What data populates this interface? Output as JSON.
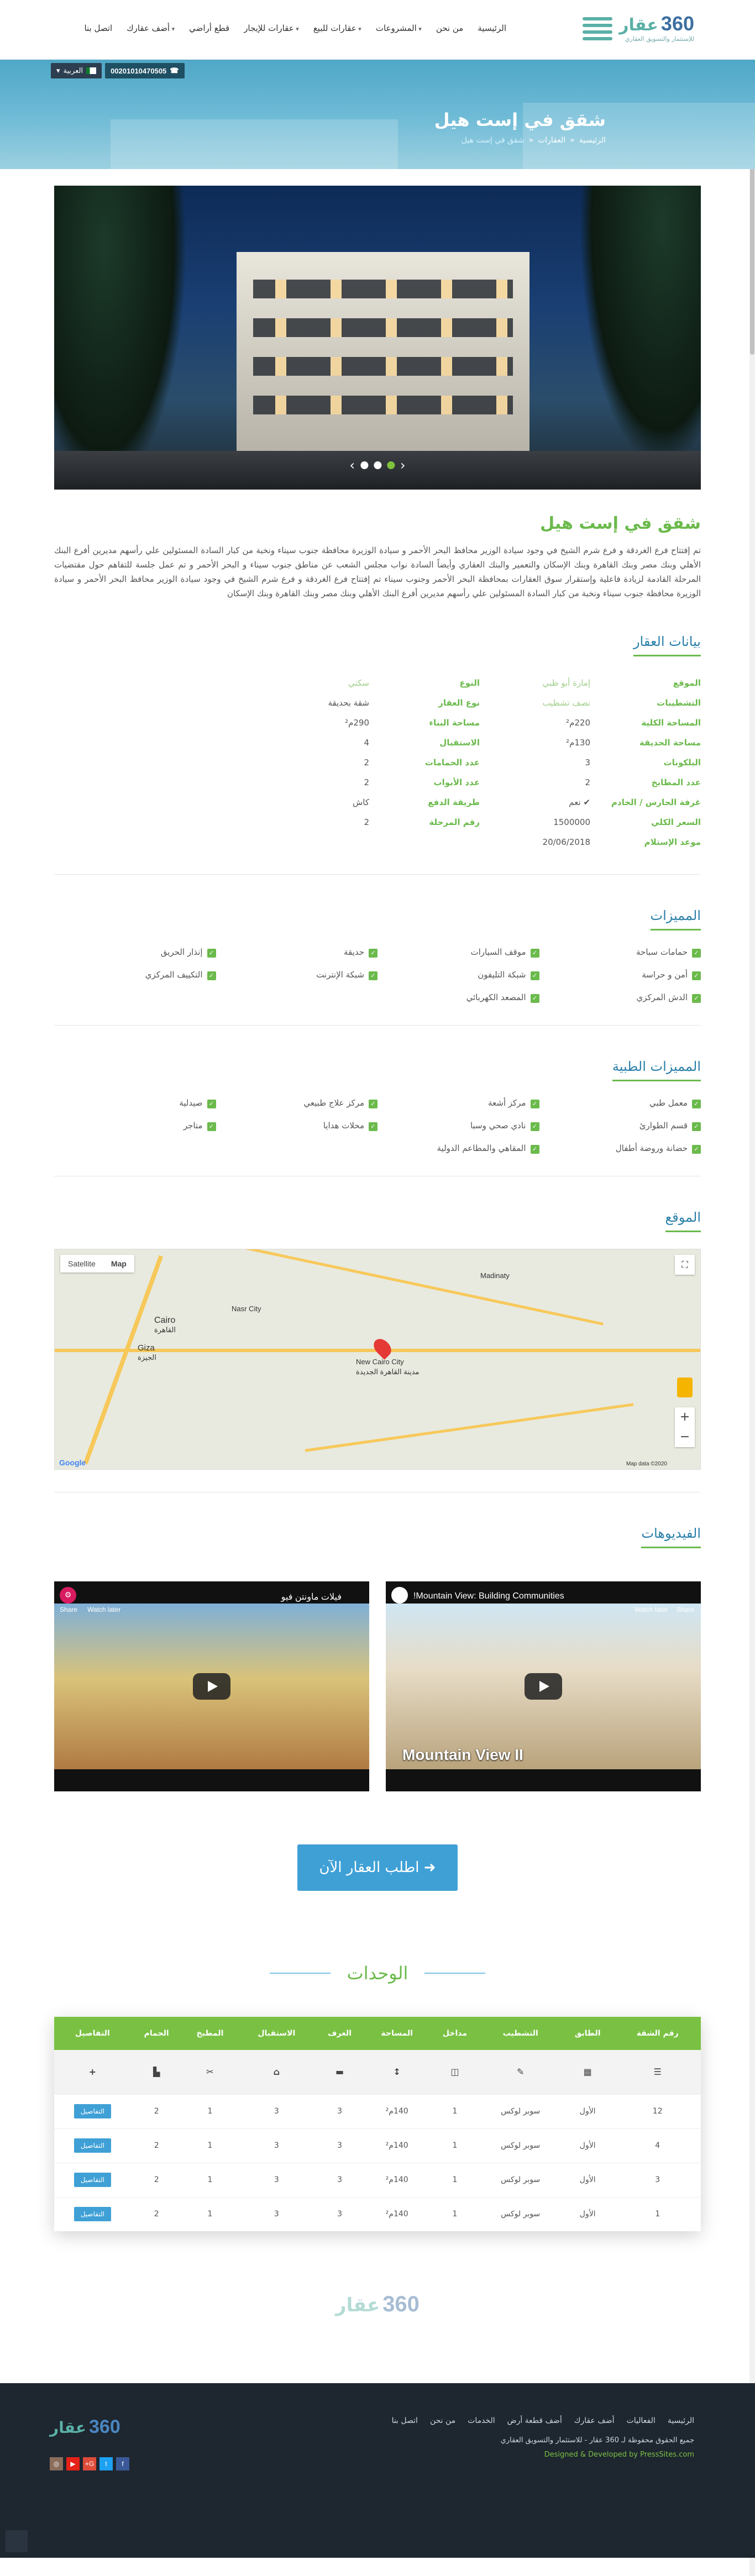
{
  "nav": {
    "logo_num": "360",
    "logo_word": "عقار",
    "logo_slogan": "للإستثمار والتسويق العقاري",
    "items": [
      "الرئيسية",
      "من نحن",
      "المشروعات",
      "عقارات للبيع",
      "عقارات للإيجار",
      "قطع أراضي",
      "أضف عقارك",
      "اتصل بنا"
    ]
  },
  "hero": {
    "title": "شقق في إست هيل",
    "crumbs": [
      "الرئيسية",
      "العقارات",
      "شقق في إست هيل"
    ],
    "phone": "00201010470505",
    "lang": "العربية"
  },
  "property": {
    "heading": "شقق في إست هيل",
    "description": "تم إفتتاح فرع الغردقة و فرع شرم الشيخ في وجود سيادة الوزير محافظ البحر الأحمر و سيادة الوزيرة محافظة جنوب سيناء ونخبة من كبار السادة المسئولين علي رأسهم مديرين أفرع البنك الأهلي وبنك مصر وبنك القاهرة وبنك الإسكان والتعمير والبنك العقاري وأيضاً السادة نواب مجلس الشعب عن مناطق جنوب سيناء و البحر الأحمر و تم عمل جلسة للتفاهم حول مقتضيات المرحلة القادمة لزيادة فاعلية وإستقرار سوق العقارات بمحافظة البحر الأحمر وجنوب سيناء تم إفتتاح فرع الغردقة و فرع شرم الشيخ في وجود سيادة الوزير محافظ البحر الأحمر و سيادة الوزيرة محافظة جنوب سيناء ونخبة من كبار السادة المسئولين علي رأسهم مديرين أفرع البنك الأهلي وبنك مصر وبنك القاهرة وبنك الإسكان"
  },
  "details": {
    "title": "بيانات العقار",
    "rows": [
      {
        "k1": "الموقع",
        "v1": "إمارة أبو ظبي",
        "k2": "النوع",
        "v2": "سكني",
        "green": true
      },
      {
        "k1": "التشطيبات",
        "v1": "نصف تشطيب",
        "k2": "نوع العقار",
        "v2": "شقة بحديقة",
        "green1": true
      },
      {
        "k1": "المساحة الكلية",
        "v1": "220م²",
        "k2": "مساحة البناء",
        "v2": "290م²"
      },
      {
        "k1": "مساحة الحديقة",
        "v1": "130م²",
        "k2": "الاستقبال",
        "v2": "4"
      },
      {
        "k1": "البلكونات",
        "v1": "3",
        "k2": "عدد الحمامات",
        "v2": "2"
      },
      {
        "k1": "عدد المطابخ",
        "v1": "2",
        "k2": "عدد الأبواب",
        "v2": "2"
      },
      {
        "k1": "غرفة الحارس / الخادم",
        "v1": "✔ نعم",
        "k2": "طريقة الدفع",
        "v2": "كاش"
      },
      {
        "k1": "السعر الكلي",
        "v1": "1500000",
        "k2": "رقم المرحلة",
        "v2": "2"
      },
      {
        "k1": "موعد الإستلام",
        "v1": "20/06/2018",
        "k2": "",
        "v2": ""
      }
    ]
  },
  "features": {
    "title": "المميزات",
    "items": [
      "حمامات سباحة",
      "موقف السيارات",
      "حديقة",
      "إنذار الحريق",
      "أمن و حراسة",
      "شبكة التليفون",
      "شبكة الإنترنت",
      "التكييف المركزي",
      "الدش المركزي",
      "المصعد الكهربائي"
    ]
  },
  "amenities": {
    "title": "المميزات الطبية",
    "items": [
      "معمل طبي",
      "مركز أشعة",
      "مركز علاج طبيعي",
      "صيدلية",
      "قسم الطوارئ",
      "نادي صحي وسبا",
      "محلات هدايا",
      "متاجر",
      "حضانة وروضة أطفال",
      "المقاهي والمطاعم الدولية"
    ]
  },
  "location": {
    "title": "الموقع",
    "map_tab": "Map",
    "sat_tab": "Satellite",
    "city": "Cairo",
    "city_ar": "القاهرة",
    "giza": "Giza",
    "giza_ar": "الجيزة",
    "new_cairo": "New Cairo City",
    "new_cairo_ar": "مدينة القاهرة الجديدة",
    "madinaty": "Madinaty",
    "nasr": "Nasr City",
    "google": "Google",
    "map_data": "Map data ©2020"
  },
  "videos": {
    "title": "الفيديوهات",
    "v1_title": "Mountain View: Building Communities!",
    "v1_caption": "Mountain View II",
    "v2_title": "فيلات ماونتن فيو",
    "watch_later": "Watch later",
    "share": "Share"
  },
  "cta": {
    "label": "اطلب العقار الآن"
  },
  "units": {
    "title": "الوحدات",
    "headers": [
      "رقم الشقة",
      "الطابق",
      "التشطيب",
      "مداخل",
      "المساحة",
      "الغرف",
      "الاستقبال",
      "المطبخ",
      "الحمام",
      "التفاصيل"
    ],
    "rows": [
      [
        "12",
        "الأول",
        "سوبر لوكس",
        "1",
        "140م²",
        "3",
        "3",
        "1",
        "2",
        "التفاصيل"
      ],
      [
        "4",
        "الأول",
        "سوبر لوكس",
        "1",
        "140م²",
        "3",
        "3",
        "1",
        "2",
        "التفاصيل"
      ],
      [
        "3",
        "الأول",
        "سوبر لوكس",
        "1",
        "140م²",
        "3",
        "3",
        "1",
        "2",
        "التفاصيل"
      ],
      [
        "1",
        "الأول",
        "سوبر لوكس",
        "1",
        "140م²",
        "3",
        "3",
        "1",
        "2",
        "التفاصيل"
      ]
    ]
  },
  "footer": {
    "links": [
      "الرئيسية",
      "الفعاليات",
      "أضف عقارك",
      "أضف قطعة أرض",
      "الخدمات",
      "من نحن",
      "اتصل بنا"
    ],
    "copyright": "جميع الحقوق محفوظة لـ 360 عقار - للاستثمار والتسويق العقاري",
    "developer": "Designed & Developed by PressSites.com",
    "logo_num": "360",
    "logo_word": "عقار",
    "social": [
      "f",
      "t",
      "G+",
      "▶",
      "◎"
    ]
  }
}
